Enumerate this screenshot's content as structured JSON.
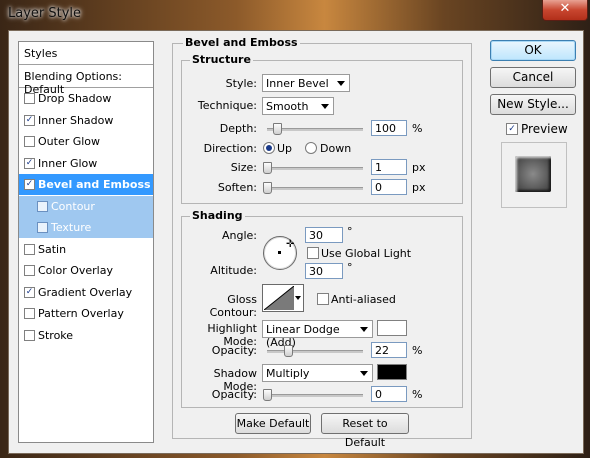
{
  "window": {
    "title": "Layer Style",
    "close_label": "✕"
  },
  "styles_panel": {
    "header": "Styles",
    "blending": "Blending Options: Default",
    "items": [
      {
        "label": "Drop Shadow",
        "checked": false
      },
      {
        "label": "Inner Shadow",
        "checked": true
      },
      {
        "label": "Outer Glow",
        "checked": false
      },
      {
        "label": "Inner Glow",
        "checked": true
      },
      {
        "label": "Bevel and Emboss",
        "checked": true,
        "selected": true
      },
      {
        "label": "Contour",
        "checked": false,
        "sub": true
      },
      {
        "label": "Texture",
        "checked": false,
        "sub": true
      },
      {
        "label": "Satin",
        "checked": false
      },
      {
        "label": "Color Overlay",
        "checked": false
      },
      {
        "label": "Gradient Overlay",
        "checked": true
      },
      {
        "label": "Pattern Overlay",
        "checked": false
      },
      {
        "label": "Stroke",
        "checked": false
      }
    ]
  },
  "bevel": {
    "title": "Bevel and Emboss",
    "structure": {
      "title": "Structure",
      "style_label": "Style:",
      "style_value": "Inner Bevel",
      "technique_label": "Technique:",
      "technique_value": "Smooth",
      "depth_label": "Depth:",
      "depth_value": "100",
      "depth_unit": "%",
      "depth_level": 0.1,
      "direction_label": "Direction:",
      "dir_up": "Up",
      "dir_down": "Down",
      "direction_selected": "Up",
      "size_label": "Size:",
      "size_value": "1",
      "size_unit": "px",
      "size_level": 0.0,
      "soften_label": "Soften:",
      "soften_value": "0",
      "soften_unit": "px",
      "soften_level": 0.0
    },
    "shading": {
      "title": "Shading",
      "angle_label": "Angle:",
      "angle_value": "30",
      "angle_unit": "°",
      "global_light_label": "Use Global Light",
      "global_light_checked": false,
      "altitude_label": "Altitude:",
      "altitude_value": "30",
      "altitude_unit": "°",
      "gloss_label": "Gloss Contour:",
      "anti_aliased_label": "Anti-aliased",
      "anti_aliased_checked": false,
      "highlight_label": "Highlight Mode:",
      "highlight_value": "Linear Dodge (Add)",
      "highlight_color": "#ffffff",
      "hl_opacity_label": "Opacity:",
      "hl_opacity_value": "22",
      "hl_opacity_unit": "%",
      "hl_opacity_level": 0.22,
      "shadow_label": "Shadow Mode:",
      "shadow_value": "Multiply",
      "shadow_color": "#000000",
      "sh_opacity_label": "Opacity:",
      "sh_opacity_value": "0",
      "sh_opacity_unit": "%",
      "sh_opacity_level": 0.0
    },
    "make_default": "Make Default",
    "reset_default": "Reset to Default"
  },
  "buttons": {
    "ok": "OK",
    "cancel": "Cancel",
    "new_style": "New Style...",
    "preview_label": "Preview",
    "preview_checked": true
  }
}
